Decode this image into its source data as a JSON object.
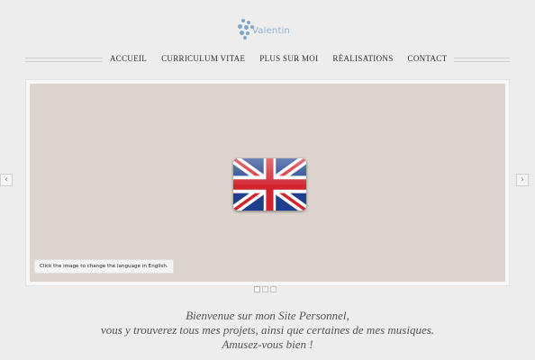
{
  "brand": {
    "name": "Valentin",
    "color": "#8eb1d0"
  },
  "nav": {
    "items": [
      {
        "label": "ACCUEIL"
      },
      {
        "label": "CURRICULUM VITAE"
      },
      {
        "label": "PLUS SUR MOI"
      },
      {
        "label": "RÉALISATIONS"
      },
      {
        "label": "CONTACT"
      }
    ]
  },
  "slider": {
    "background": "#dcd4cd",
    "image": {
      "icon": "uk-flag-icon"
    },
    "caption": "Click the image to change the language in English.",
    "prev_label": "‹",
    "next_label": "›",
    "bullets": 3,
    "active_bullet": 1
  },
  "welcome": {
    "line1": "Bienvenue sur mon Site Personnel,",
    "line2": "vous y trouverez tous mes projets, ainsi que certaines de mes musiques.",
    "line3": "Amusez-vous bien !"
  }
}
